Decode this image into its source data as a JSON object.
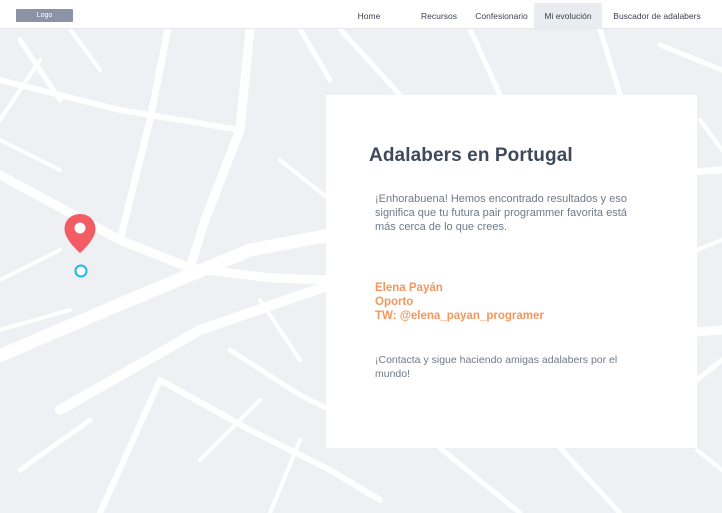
{
  "app": {
    "logo_label": "Logo"
  },
  "nav": {
    "home": "Home",
    "recursos": "Recursos",
    "confesionario": "Confesionario",
    "mi_evolucion": "Mi evolución",
    "buscador": "Buscador de adalabers",
    "active": "Mi evolución"
  },
  "map": {
    "marker_icon": "map-pin-icon",
    "location_icon": "location-dot-icon",
    "colors": {
      "background": "#eef0f4",
      "roads": "#ffffff",
      "pin": "#f25c62",
      "location_ring": "#1fb7ec"
    }
  },
  "result_card": {
    "title": "Adalabers en Portugal",
    "intro": "¡Enhorabuena! Hemos encontrado resultados y eso significa que tu futura pair programmer favorita está más cerca de lo que crees.",
    "name": "Elena Payán",
    "city": "Oporto",
    "twitter": "TW: @elena_payan_programer",
    "outro": "¡Contacta y sigue haciendo amigas adalabers por el mundo!",
    "accent_color": "#f7965b"
  }
}
